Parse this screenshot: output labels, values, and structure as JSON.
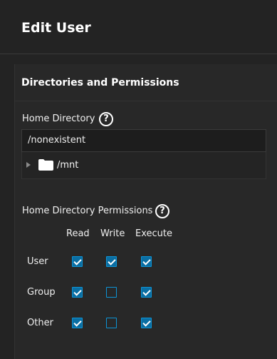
{
  "header": {
    "title": "Edit User"
  },
  "section": {
    "title": "Directories and Permissions"
  },
  "home_directory": {
    "label": "Home Directory",
    "value": "/nonexistent",
    "tree_item": "/mnt"
  },
  "permissions": {
    "label": "Home Directory Permissions",
    "columns": [
      "Read",
      "Write",
      "Execute"
    ],
    "rows": [
      {
        "label": "User",
        "read": true,
        "write": true,
        "execute": true
      },
      {
        "label": "Group",
        "read": true,
        "write": false,
        "execute": true
      },
      {
        "label": "Other",
        "read": true,
        "write": false,
        "execute": true
      }
    ]
  },
  "colors": {
    "accent": "#0d94d6",
    "background": "#232323"
  }
}
